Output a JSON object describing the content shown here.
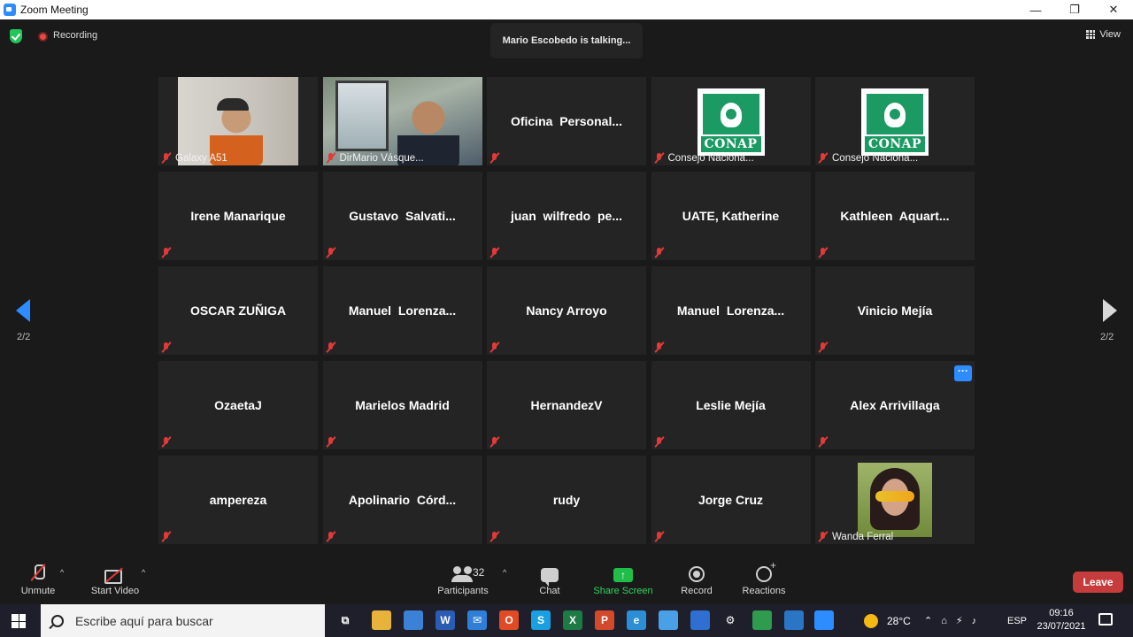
{
  "window": {
    "title": "Zoom Meeting",
    "minimize": "—",
    "maximize": "❐",
    "close": "✕"
  },
  "topbar": {
    "recording_label": "Recording",
    "talking": "Mario Escobedo is talking...",
    "view_label": "View"
  },
  "gallery": {
    "page_left": "2/2",
    "page_right": "2/2",
    "tiles": [
      {
        "name": "Galaxy A51",
        "type": "video"
      },
      {
        "name": "DirMario Vásque...",
        "type": "video"
      },
      {
        "name": "Oficina  Personal...",
        "type": "text"
      },
      {
        "name": "Consejo Naciona...",
        "type": "logo",
        "logo_text": "CONAP"
      },
      {
        "name": "Consejo Naciona...",
        "type": "logo",
        "logo_text": "CONAP"
      },
      {
        "name": "Irene Manarique",
        "type": "text"
      },
      {
        "name": "Gustavo  Salvati...",
        "type": "text"
      },
      {
        "name": "juan  wilfredo  pe...",
        "type": "text"
      },
      {
        "name": "UATE, Katherine",
        "type": "text"
      },
      {
        "name": "Kathleen  Aquart...",
        "type": "text"
      },
      {
        "name": "OSCAR ZUÑIGA",
        "type": "text"
      },
      {
        "name": "Manuel  Lorenza...",
        "type": "text"
      },
      {
        "name": "Nancy Arroyo",
        "type": "text"
      },
      {
        "name": "Manuel  Lorenza...",
        "type": "text"
      },
      {
        "name": "Vinicio Mejía",
        "type": "text"
      },
      {
        "name": "OzaetaJ",
        "type": "text"
      },
      {
        "name": "Marielos Madrid",
        "type": "text"
      },
      {
        "name": "HernandezV",
        "type": "text"
      },
      {
        "name": "Leslie Mejía",
        "type": "text"
      },
      {
        "name": "Alex Arrivillaga",
        "type": "text",
        "more": "···"
      },
      {
        "name": "ampereza",
        "type": "text"
      },
      {
        "name": "Apolinario  Córd...",
        "type": "text"
      },
      {
        "name": "rudy",
        "type": "text"
      },
      {
        "name": "Jorge Cruz",
        "type": "text"
      },
      {
        "name": "Wanda Ferral",
        "type": "photo"
      }
    ]
  },
  "toolbar": {
    "unmute": "Unmute",
    "start_video": "Start Video",
    "participants": "Participants",
    "participants_count": "32",
    "chat": "Chat",
    "share_screen": "Share Screen",
    "share_symbol": "↑",
    "record": "Record",
    "reactions": "Reactions",
    "leave": "Leave",
    "caret": "^"
  },
  "taskbar": {
    "search_placeholder": "Escribe aquí para buscar",
    "weather": "28°C",
    "language": "ESP",
    "time": "09:16",
    "date": "23/07/2021",
    "apps": [
      {
        "name": "task-view",
        "label": "⧉",
        "color": "#1f1f2b"
      },
      {
        "name": "file-explorer",
        "label": "",
        "color": "#e8b33a"
      },
      {
        "name": "store",
        "label": "",
        "color": "#3b82d6"
      },
      {
        "name": "word",
        "label": "W",
        "color": "#2b5cb4"
      },
      {
        "name": "mail",
        "label": "✉",
        "color": "#2f7fd9"
      },
      {
        "name": "office",
        "label": "O",
        "color": "#e04a24"
      },
      {
        "name": "skype",
        "label": "S",
        "color": "#1a9fe0"
      },
      {
        "name": "excel",
        "label": "X",
        "color": "#1e7a44"
      },
      {
        "name": "powerpoint",
        "label": "P",
        "color": "#d2492b"
      },
      {
        "name": "edge",
        "label": "e",
        "color": "#2c8fd6"
      },
      {
        "name": "onedrive",
        "label": "",
        "color": "#4aa0e6"
      },
      {
        "name": "calendar",
        "label": "",
        "color": "#2f6fd1"
      },
      {
        "name": "settings",
        "label": "⚙",
        "color": "#1f1f2b"
      },
      {
        "name": "chrome",
        "label": "",
        "color": "#2e9b4d"
      },
      {
        "name": "photos",
        "label": "",
        "color": "#2a76c6"
      },
      {
        "name": "zoom",
        "label": "",
        "color": "#2d8cff"
      }
    ]
  }
}
